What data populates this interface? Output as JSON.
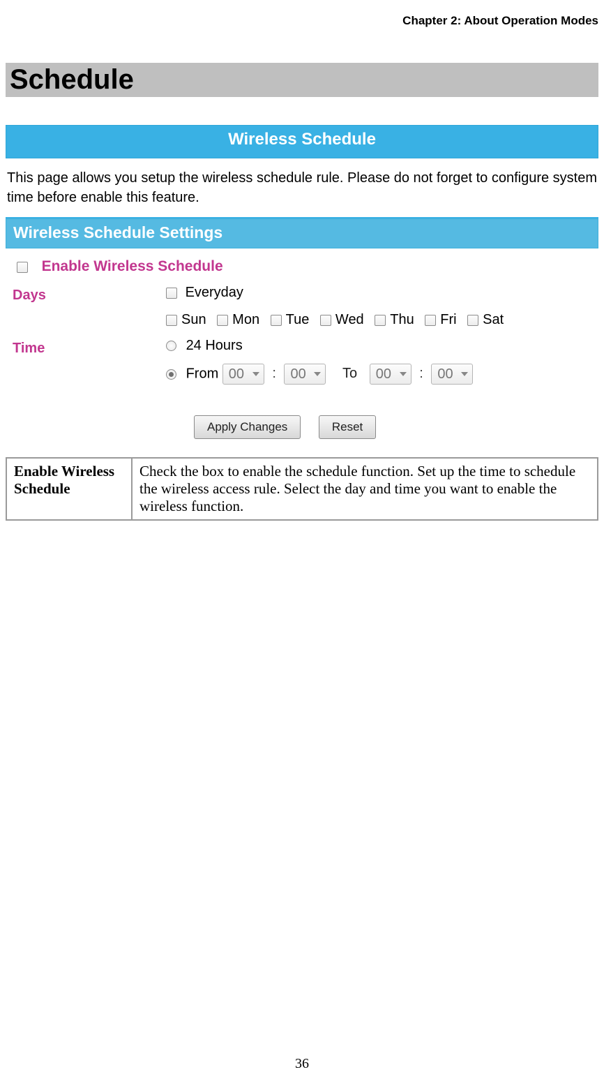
{
  "chapter_header": "Chapter 2: About Operation Modes",
  "section_heading": "Schedule",
  "page_number": "36",
  "ui": {
    "title_banner": "Wireless Schedule",
    "intro": "This page allows you setup the wireless schedule rule. Please do not forget to configure system time before enable this feature.",
    "settings_banner": "Wireless Schedule Settings",
    "enable_label": "Enable Wireless Schedule",
    "days_label": "Days",
    "everyday": "Everyday",
    "days": [
      "Sun",
      "Mon",
      "Tue",
      "Wed",
      "Thu",
      "Fri",
      "Sat"
    ],
    "time_label": "Time",
    "t24": "24 Hours",
    "from_label": "From",
    "to_label": "To",
    "hh1": "00",
    "mm1": "00",
    "hh2": "00",
    "mm2": "00",
    "apply_btn": "Apply Changes",
    "reset_btn": "Reset"
  },
  "def": {
    "term": "Enable Wireless Schedule",
    "desc": "Check the box to enable the schedule function. Set up the time to schedule the wireless access rule. Select the day and time you want to enable the wireless function."
  }
}
